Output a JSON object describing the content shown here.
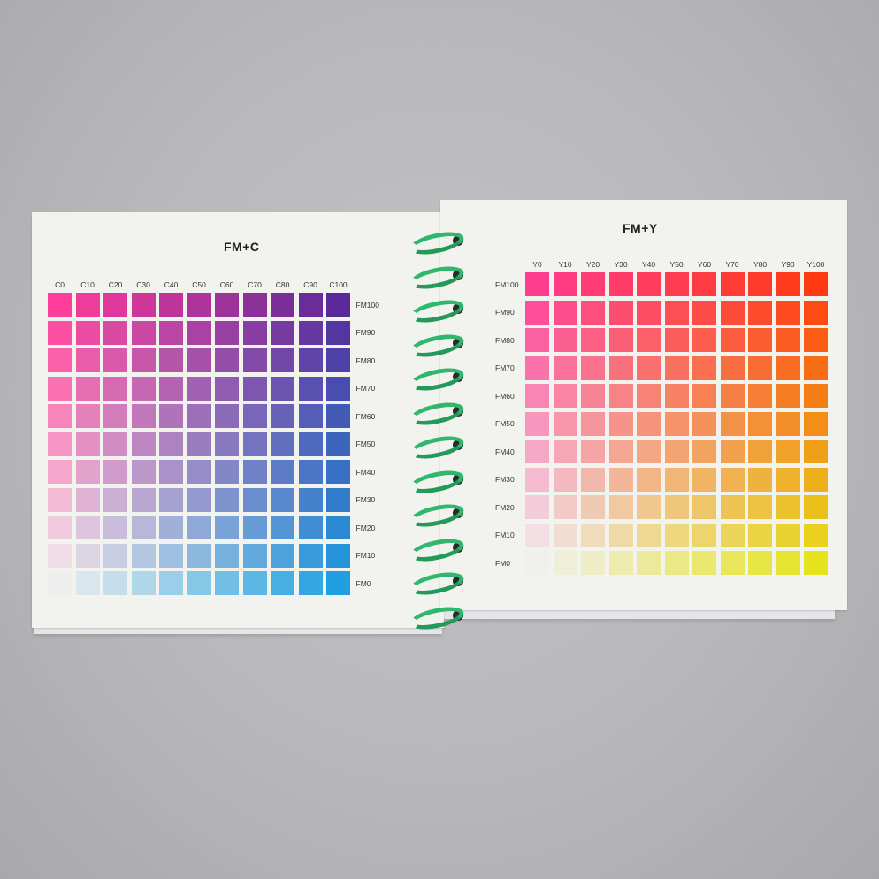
{
  "left_chart": {
    "title": "FM+C",
    "columns": [
      "C0",
      "C10",
      "C20",
      "C30",
      "C40",
      "C50",
      "C60",
      "C70",
      "C80",
      "C90",
      "C100"
    ],
    "rows": [
      "FM100",
      "FM90",
      "FM80",
      "FM70",
      "FM60",
      "FM50",
      "FM40",
      "FM30",
      "FM20",
      "FM10",
      "FM0"
    ],
    "colors": {
      "m100_c0": "#ff3d9a",
      "m100_c100": "#5a2a9a",
      "m0_c0": "#eeeeee",
      "m0_c100": "#1f9fe0"
    }
  },
  "right_chart": {
    "title": "FM+Y",
    "columns": [
      "Y0",
      "Y10",
      "Y20",
      "Y30",
      "Y40",
      "Y50",
      "Y60",
      "Y70",
      "Y80",
      "Y90",
      "Y100"
    ],
    "rows": [
      "FM100",
      "FM90",
      "FM80",
      "FM70",
      "FM60",
      "FM50",
      "FM40",
      "FM30",
      "FM20",
      "FM10",
      "FM0"
    ],
    "colors": {
      "m100_y0": "#ff3d8f",
      "m100_y100": "#ff3a10",
      "m0_y0": "#f0f0ec",
      "m0_y100": "#e6e21e"
    }
  },
  "binding": {
    "ring_color": "#2fb86d",
    "ring_count": 12
  }
}
